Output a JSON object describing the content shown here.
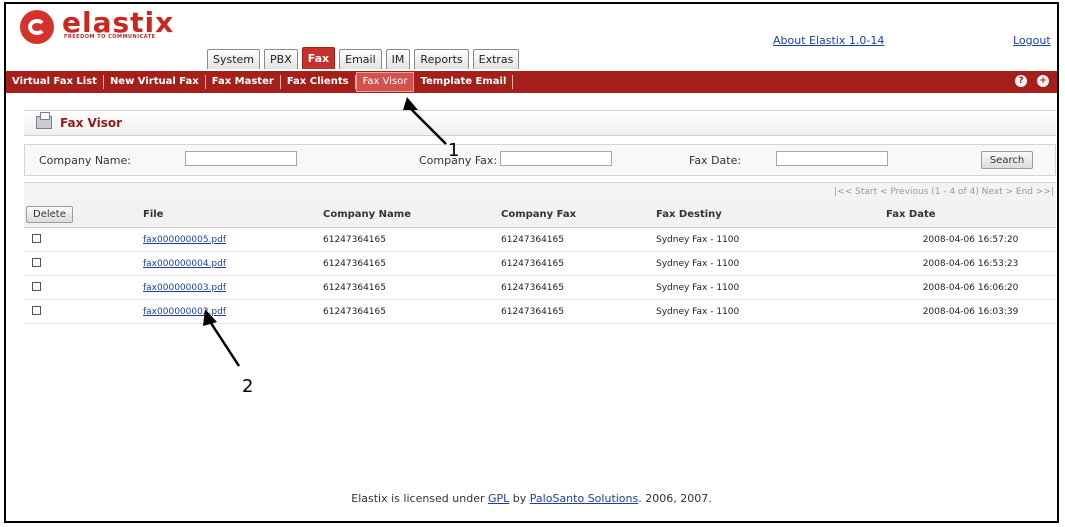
{
  "brand": {
    "name": "elastix",
    "tagline": "FREEDOM TO COMMUNICATE"
  },
  "header": {
    "about_link": "About Elastix 1.0-14",
    "logout_link": "Logout"
  },
  "tabs": [
    {
      "label": "System"
    },
    {
      "label": "PBX"
    },
    {
      "label": "Fax",
      "active": true
    },
    {
      "label": "Email"
    },
    {
      "label": "IM"
    },
    {
      "label": "Reports"
    },
    {
      "label": "Extras"
    }
  ],
  "subnav": {
    "items": [
      {
        "label": "Virtual Fax List"
      },
      {
        "label": "New Virtual Fax"
      },
      {
        "label": "Fax Master"
      },
      {
        "label": "Fax Clients"
      },
      {
        "label": "Fax Visor",
        "current": true
      },
      {
        "label": "Template Email"
      }
    ],
    "help_icon": "?",
    "settings_icon": "+"
  },
  "page": {
    "title": "Fax Visor",
    "icon": "printer-icon"
  },
  "filters": {
    "company_name_label": "Company Name:",
    "company_name_value": "",
    "company_fax_label": "Company Fax:",
    "company_fax_value": "",
    "fax_date_label": "Fax Date:",
    "fax_date_value": "",
    "search_button": "Search"
  },
  "pager": {
    "text": "|<< Start < Previous (1 - 4 of 4) Next > End >>|"
  },
  "table": {
    "delete_button": "Delete",
    "columns": [
      "File",
      "Company Name",
      "Company Fax",
      "Fax Destiny",
      "Fax Date"
    ],
    "rows": [
      {
        "file": "fax000000005.pdf",
        "company_name": "61247364165",
        "company_fax": "61247364165",
        "fax_destiny": "Sydney Fax - 1100",
        "fax_date": "2008-04-06 16:57:20"
      },
      {
        "file": "fax000000004.pdf",
        "company_name": "61247364165",
        "company_fax": "61247364165",
        "fax_destiny": "Sydney Fax - 1100",
        "fax_date": "2008-04-06 16:53:23"
      },
      {
        "file": "fax000000003.pdf",
        "company_name": "61247364165",
        "company_fax": "61247364165",
        "fax_destiny": "Sydney Fax - 1100",
        "fax_date": "2008-04-06 16:06:20"
      },
      {
        "file": "fax000000002.pdf",
        "company_name": "61247364165",
        "company_fax": "61247364165",
        "fax_destiny": "Sydney Fax - 1100",
        "fax_date": "2008-04-06 16:03:39"
      }
    ]
  },
  "annotations": {
    "label_1": "1",
    "label_2": "2"
  },
  "footer": {
    "prefix": "Elastix is licensed under ",
    "gpl_link": "GPL",
    "middle": " by ",
    "company_link": "PaloSanto Solutions",
    "suffix": ". 2006, 2007."
  },
  "colors": {
    "brand_red": "#c8302c",
    "subnav_red": "#a51f1b",
    "link_blue": "#1a3fa0"
  }
}
